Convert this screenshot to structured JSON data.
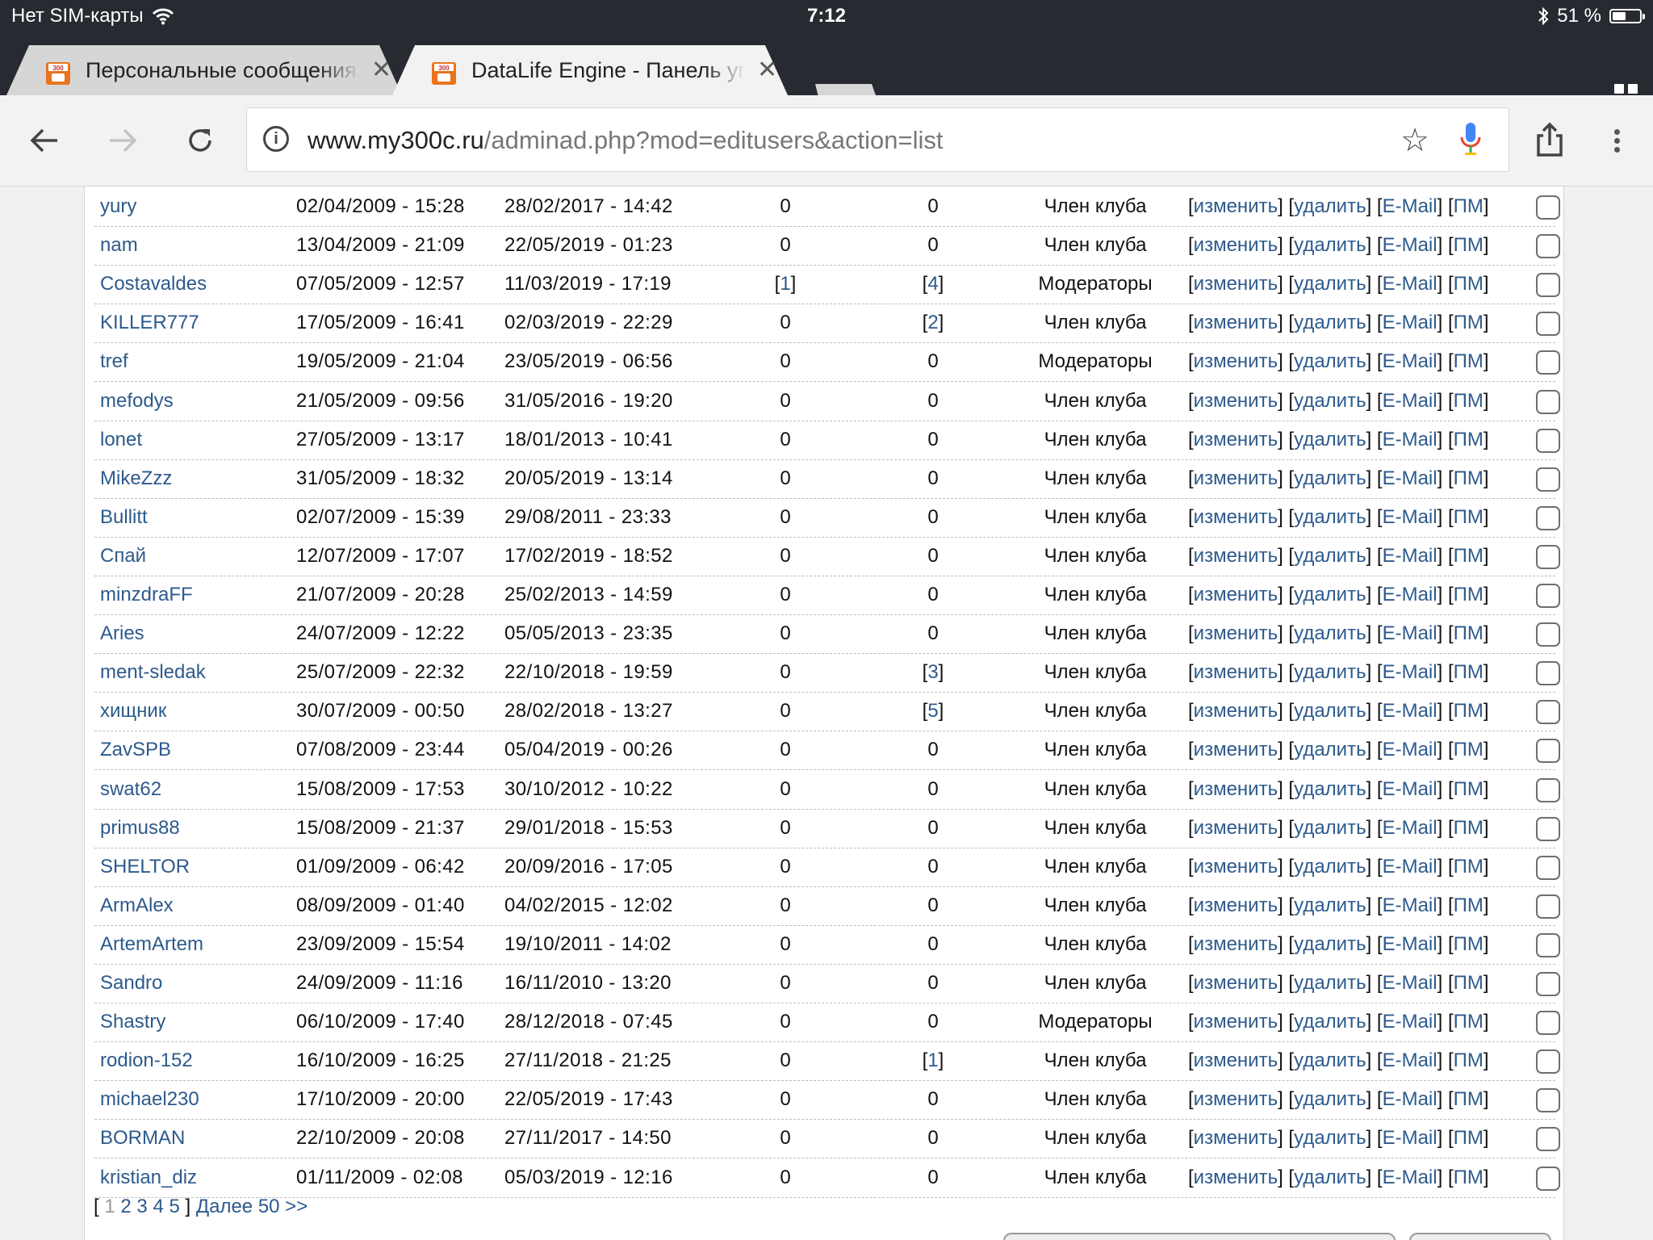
{
  "status_bar": {
    "carrier": "Нет SIM-карты",
    "time": "7:12",
    "battery": "51 %",
    "battery_level": 0.51
  },
  "tabs": [
    {
      "title": "Персональные сообщения",
      "active": false
    },
    {
      "title": "DataLife Engine - Панель управления",
      "active": true
    }
  ],
  "toolbar": {
    "url_domain": "www.my300c.ru",
    "url_path": "/adminad.php?mod=editusers&action=list"
  },
  "table": {
    "actions": {
      "edit": "изменить",
      "delete": "удалить",
      "email": "E-Mail",
      "pm": "ПМ"
    },
    "rows": [
      {
        "name": "yury",
        "registered": "02/04/2009 - 15:28",
        "last_visit": "28/02/2017 - 14:42",
        "col1": "0",
        "col2": "0",
        "group": "Член клуба"
      },
      {
        "name": "nam",
        "registered": "13/04/2009 - 21:09",
        "last_visit": "22/05/2019 - 01:23",
        "col1": "0",
        "col2": "0",
        "group": "Член клуба"
      },
      {
        "name": "Costavaldes",
        "registered": "07/05/2009 - 12:57",
        "last_visit": "11/03/2019 - 17:19",
        "col1": "1",
        "col2": "4",
        "group": "Модераторы"
      },
      {
        "name": "KILLER777",
        "registered": "17/05/2009 - 16:41",
        "last_visit": "02/03/2019 - 22:29",
        "col1": "0",
        "col2": "2",
        "group": "Член клуба"
      },
      {
        "name": "tref",
        "registered": "19/05/2009 - 21:04",
        "last_visit": "23/05/2019 - 06:56",
        "col1": "0",
        "col2": "0",
        "group": "Модераторы"
      },
      {
        "name": "mefodys",
        "registered": "21/05/2009 - 09:56",
        "last_visit": "31/05/2016 - 19:20",
        "col1": "0",
        "col2": "0",
        "group": "Член клуба"
      },
      {
        "name": "lonet",
        "registered": "27/05/2009 - 13:17",
        "last_visit": "18/01/2013 - 10:41",
        "col1": "0",
        "col2": "0",
        "group": "Член клуба"
      },
      {
        "name": "MikeZzz",
        "registered": "31/05/2009 - 18:32",
        "last_visit": "20/05/2019 - 13:14",
        "col1": "0",
        "col2": "0",
        "group": "Член клуба"
      },
      {
        "name": "Bullitt",
        "registered": "02/07/2009 - 15:39",
        "last_visit": "29/08/2011 - 23:33",
        "col1": "0",
        "col2": "0",
        "group": "Член клуба"
      },
      {
        "name": "Спай",
        "registered": "12/07/2009 - 17:07",
        "last_visit": "17/02/2019 - 18:52",
        "col1": "0",
        "col2": "0",
        "group": "Член клуба"
      },
      {
        "name": "minzdraFF",
        "registered": "21/07/2009 - 20:28",
        "last_visit": "25/02/2013 - 14:59",
        "col1": "0",
        "col2": "0",
        "group": "Член клуба"
      },
      {
        "name": "Aries",
        "registered": "24/07/2009 - 12:22",
        "last_visit": "05/05/2013 - 23:35",
        "col1": "0",
        "col2": "0",
        "group": "Член клуба"
      },
      {
        "name": "ment-sledak",
        "registered": "25/07/2009 - 22:32",
        "last_visit": "22/10/2018 - 19:59",
        "col1": "0",
        "col2": "3",
        "group": "Член клуба"
      },
      {
        "name": "хищник",
        "registered": "30/07/2009 - 00:50",
        "last_visit": "28/02/2018 - 13:27",
        "col1": "0",
        "col2": "5",
        "group": "Член клуба"
      },
      {
        "name": "ZavSPB",
        "registered": "07/08/2009 - 23:44",
        "last_visit": "05/04/2019 - 00:26",
        "col1": "0",
        "col2": "0",
        "group": "Член клуба"
      },
      {
        "name": "swat62",
        "registered": "15/08/2009 - 17:53",
        "last_visit": "30/10/2012 - 10:22",
        "col1": "0",
        "col2": "0",
        "group": "Член клуба"
      },
      {
        "name": "primus88",
        "registered": "15/08/2009 - 21:37",
        "last_visit": "29/01/2018 - 15:53",
        "col1": "0",
        "col2": "0",
        "group": "Член клуба"
      },
      {
        "name": "SHELTOR",
        "registered": "01/09/2009 - 06:42",
        "last_visit": "20/09/2016 - 17:05",
        "col1": "0",
        "col2": "0",
        "group": "Член клуба"
      },
      {
        "name": "ArmAlex",
        "registered": "08/09/2009 - 01:40",
        "last_visit": "04/02/2015 - 12:02",
        "col1": "0",
        "col2": "0",
        "group": "Член клуба"
      },
      {
        "name": "ArtemArtem",
        "registered": "23/09/2009 - 15:54",
        "last_visit": "19/10/2011 - 14:02",
        "col1": "0",
        "col2": "0",
        "group": "Член клуба"
      },
      {
        "name": "Sandro",
        "registered": "24/09/2009 - 11:16",
        "last_visit": "16/11/2010 - 13:20",
        "col1": "0",
        "col2": "0",
        "group": "Член клуба"
      },
      {
        "name": "Shastry",
        "registered": "06/10/2009 - 17:40",
        "last_visit": "28/12/2018 - 07:45",
        "col1": "0",
        "col2": "0",
        "group": "Модераторы"
      },
      {
        "name": "rodion-152",
        "registered": "16/10/2009 - 16:25",
        "last_visit": "27/11/2018 - 21:25",
        "col1": "0",
        "col2": "1",
        "group": "Член клуба"
      },
      {
        "name": "michael230",
        "registered": "17/10/2009 - 20:00",
        "last_visit": "22/05/2019 - 17:43",
        "col1": "0",
        "col2": "0",
        "group": "Член клуба"
      },
      {
        "name": "BORMAN",
        "registered": "22/10/2009 - 20:08",
        "last_visit": "27/11/2017 - 14:50",
        "col1": "0",
        "col2": "0",
        "group": "Член клуба"
      },
      {
        "name": "kristian_diz",
        "registered": "01/11/2009 - 02:08",
        "last_visit": "05/03/2019 - 12:16",
        "col1": "0",
        "col2": "0",
        "group": "Член клуба"
      }
    ]
  },
  "pager": {
    "open": "[",
    "current": "1",
    "pages": [
      "2",
      "3",
      "4",
      "5"
    ],
    "close": "]",
    "next": "Далее 50 >>"
  }
}
